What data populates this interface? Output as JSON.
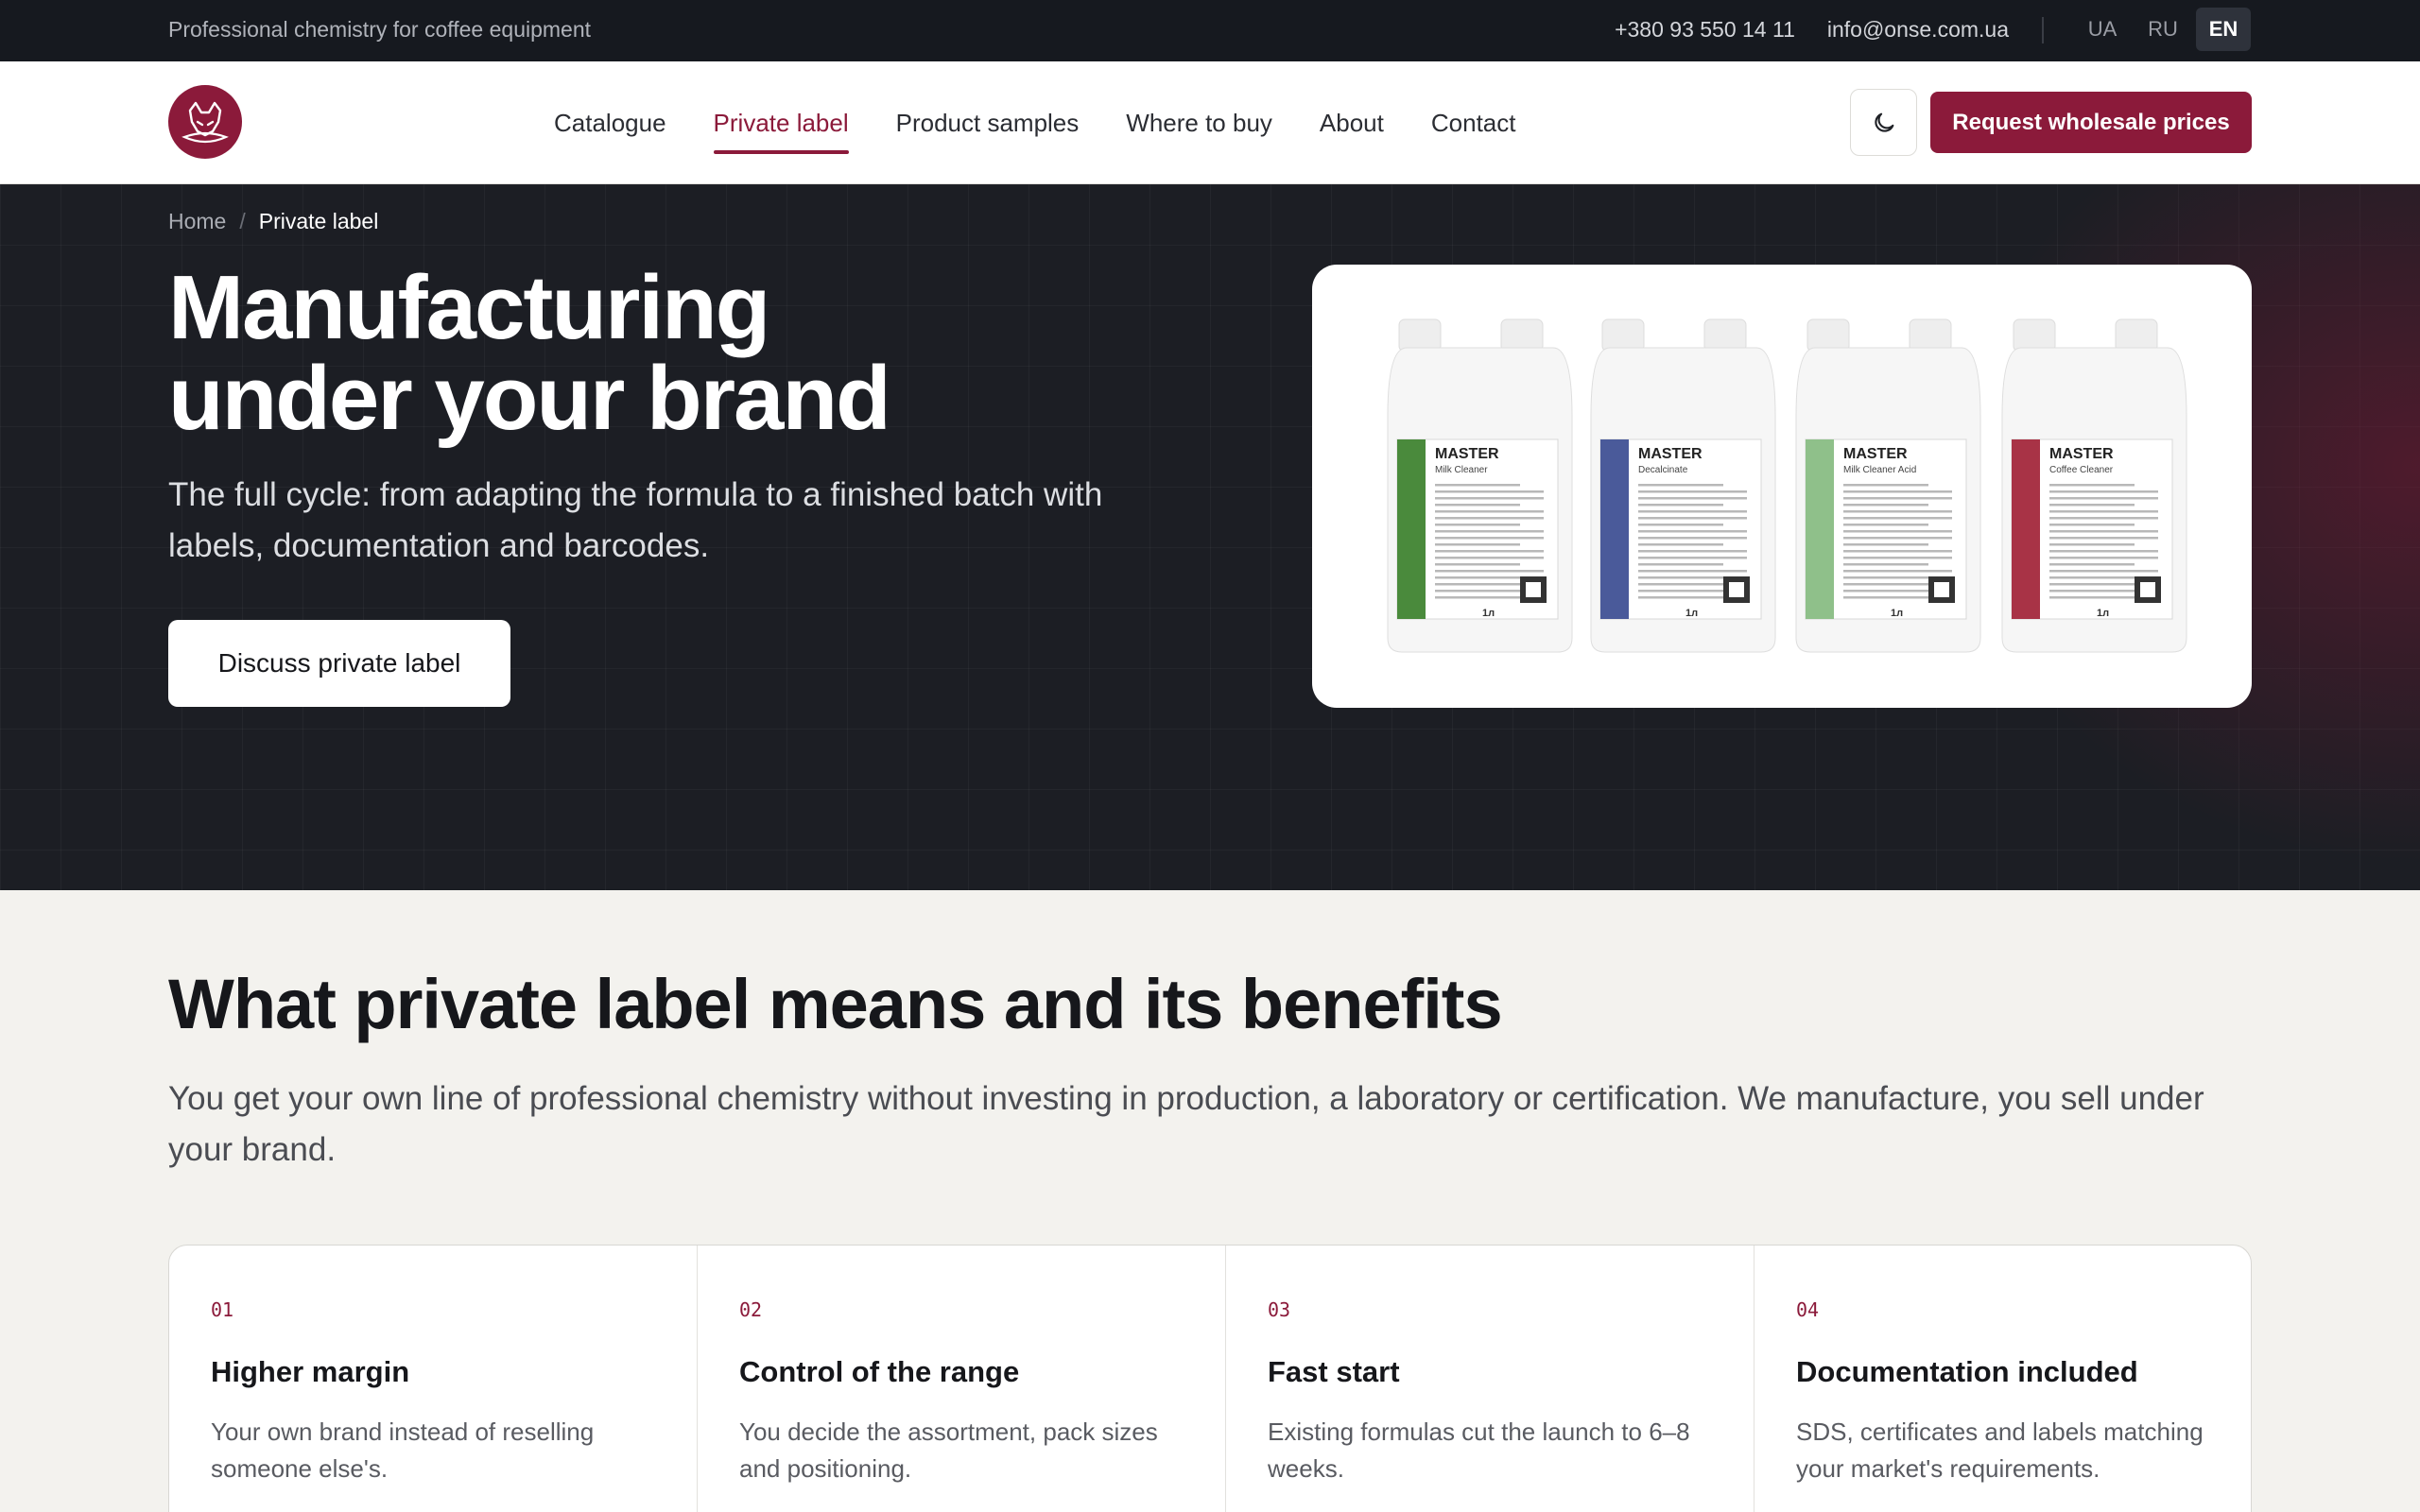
{
  "topbar": {
    "tagline": "Professional chemistry for coffee equipment",
    "phone": "+380 93 550 14 11",
    "email": "info@onse.com.ua",
    "languages": [
      "UA",
      "RU",
      "EN"
    ],
    "active_language": "EN"
  },
  "header": {
    "nav": [
      {
        "label": "Catalogue"
      },
      {
        "label": "Private label"
      },
      {
        "label": "Product samples"
      },
      {
        "label": "Where to buy"
      },
      {
        "label": "About"
      },
      {
        "label": "Contact"
      }
    ],
    "active_nav": "Private label",
    "cta_label": "Request wholesale prices",
    "theme_icon": "moon-icon",
    "brand_color": "#8b1a3a"
  },
  "hero": {
    "breadcrumb": {
      "home": "Home",
      "separator": "/",
      "current": "Private label"
    },
    "title_line1": "Manufacturing",
    "title_line2": "under your brand",
    "subtitle": "The full cycle: from adapting the formula to a finished batch with labels, documentation and barcodes.",
    "button_label": "Discuss private label",
    "products": [
      {
        "brand": "MASTER",
        "name": "Milk Cleaner",
        "volume": "1л",
        "stripe": "#4a8a3c"
      },
      {
        "brand": "MASTER",
        "name": "Decalcinate",
        "volume": "1л",
        "stripe": "#4a5a9a"
      },
      {
        "brand": "MASTER",
        "name": "Milk Cleaner Acid",
        "volume": "1л",
        "stripe": "#8fc08a"
      },
      {
        "brand": "MASTER",
        "name": "Coffee Cleaner",
        "volume": "1л",
        "stripe": "#a83346"
      }
    ]
  },
  "benefits": {
    "title": "What private label means and its benefits",
    "subtitle": "You get your own line of professional chemistry without investing in production, a laboratory or certification. We manufacture, you sell under your brand.",
    "items": [
      {
        "num": "01",
        "title": "Higher margin",
        "desc": "Your own brand instead of reselling someone else's."
      },
      {
        "num": "02",
        "title": "Control of the range",
        "desc": "You decide the assortment, pack sizes and positioning."
      },
      {
        "num": "03",
        "title": "Fast start",
        "desc": "Existing formulas cut the launch to 6–8 weeks."
      },
      {
        "num": "04",
        "title": "Documentation included",
        "desc": "SDS, certificates and labels matching your market's requirements."
      }
    ]
  }
}
